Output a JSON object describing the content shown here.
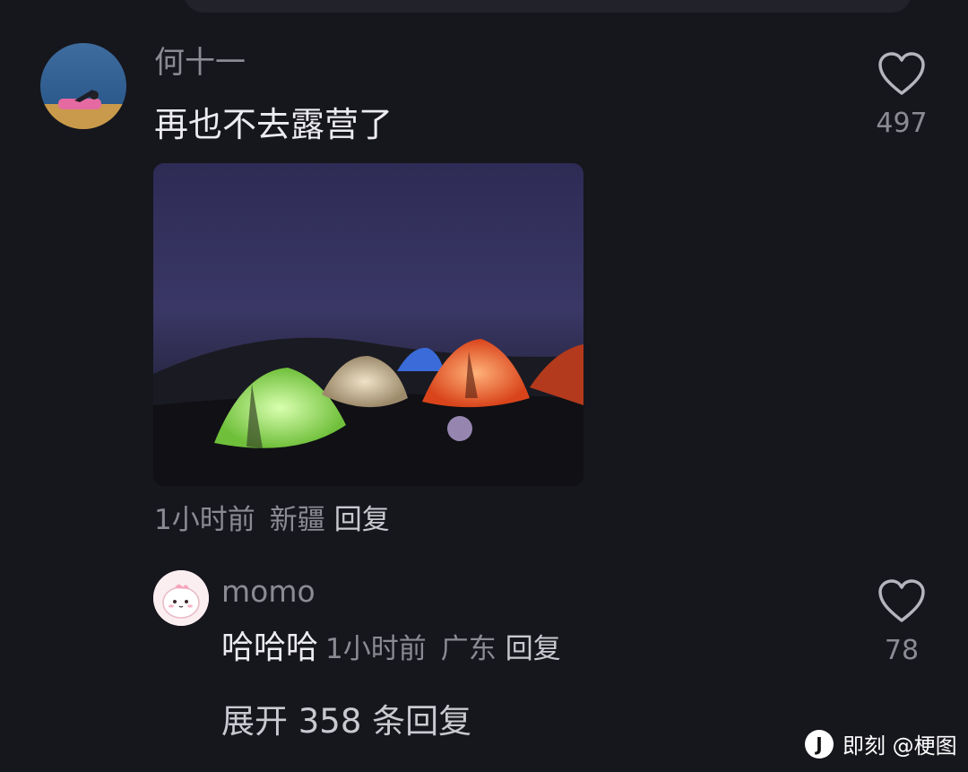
{
  "comment": {
    "username": "何十一",
    "text": "再也不去露营了",
    "time": "1小时前",
    "location": "新疆",
    "reply_label": "回复",
    "like_count": "497"
  },
  "reply": {
    "username": "momo",
    "text": "哈哈哈",
    "time": "1小时前",
    "location": "广东",
    "reply_label": "回复",
    "like_count": "78"
  },
  "expand_label": "展开 358 条回复",
  "watermark": {
    "logo": "J",
    "text": "即刻 @梗图"
  },
  "icons": {
    "like": "heart-outline-icon"
  },
  "colors": {
    "background": "#16161d",
    "primary_text": "#ebebf0",
    "secondary_text": "#8b8b93"
  }
}
